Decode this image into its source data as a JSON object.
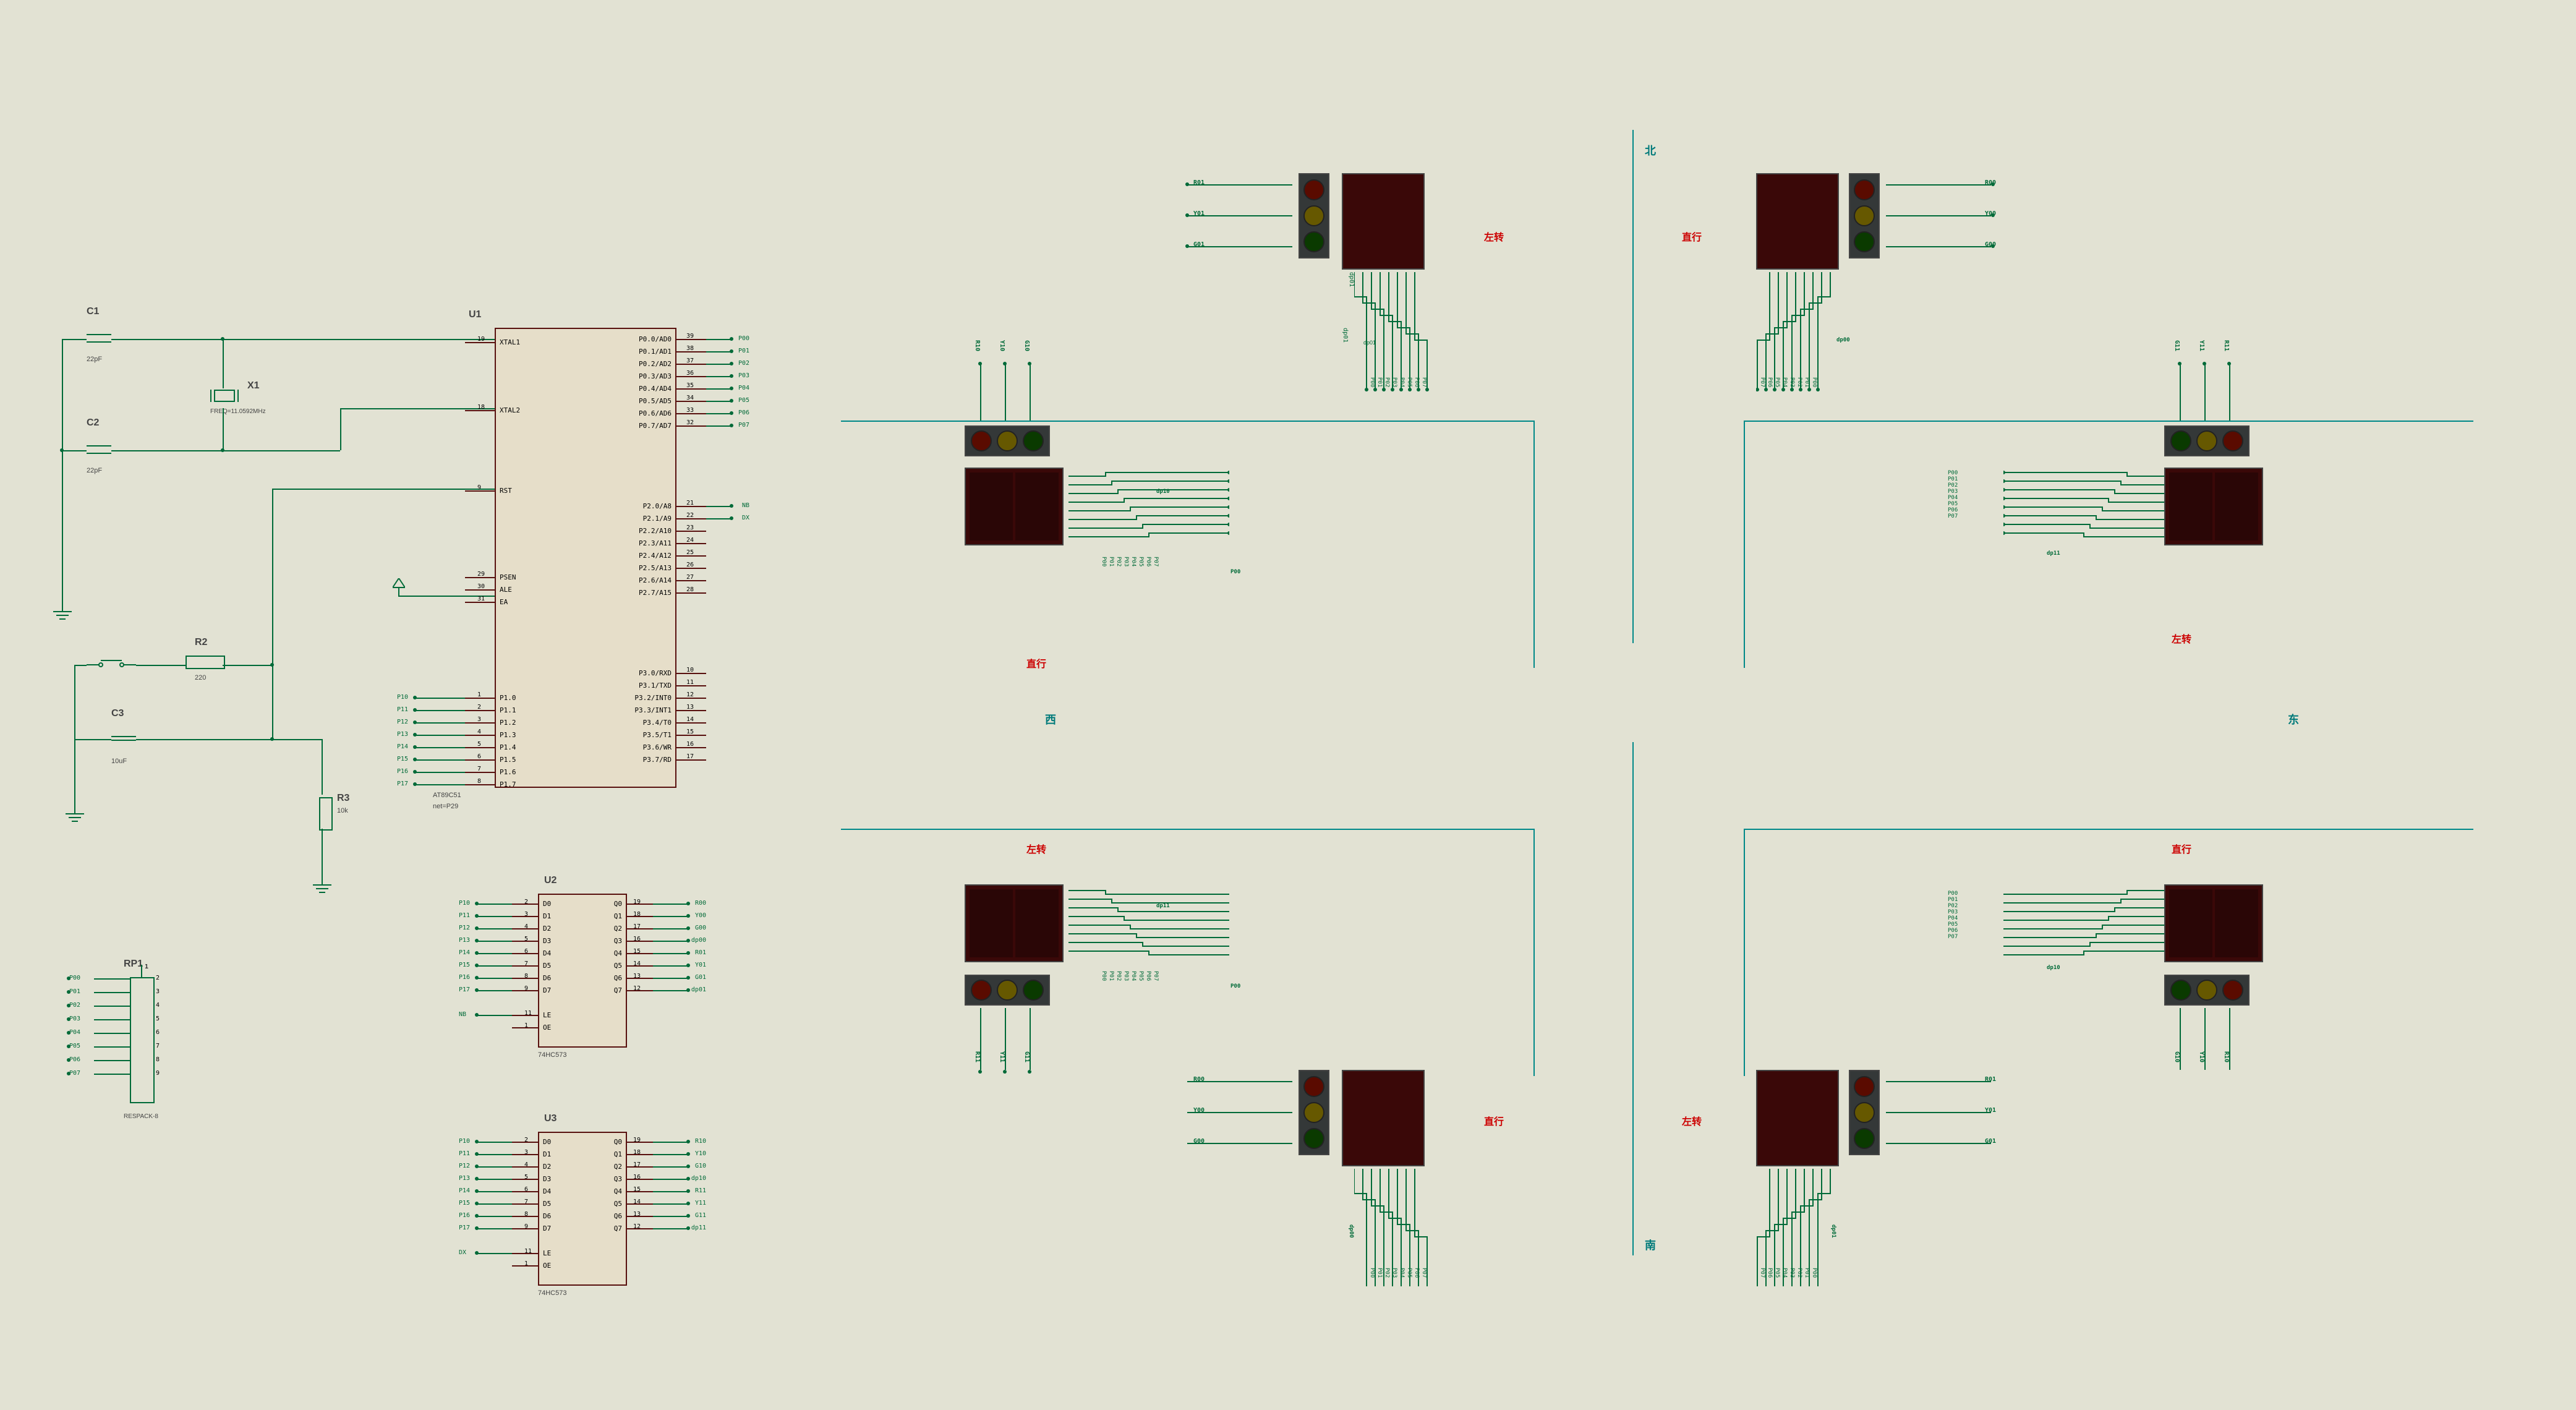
{
  "parts": {
    "c1": {
      "ref": "C1",
      "val": "22pF"
    },
    "c2": {
      "ref": "C2",
      "val": "22pF"
    },
    "c3": {
      "ref": "C3",
      "val": "10uF"
    },
    "x1": {
      "ref": "X1",
      "val": "FREQ=11.0592MHz"
    },
    "r2": {
      "ref": "R2",
      "val": "220"
    },
    "r3": {
      "ref": "R3",
      "val": "10k"
    },
    "u1": {
      "ref": "U1",
      "val": "AT89C51",
      "net": "net=P29"
    },
    "u2": {
      "ref": "U2",
      "val": "74HC573"
    },
    "u3": {
      "ref": "U3",
      "val": "74HC573"
    },
    "rp1": {
      "ref": "RP1",
      "val": "RESPACK-8"
    }
  },
  "rp1_pins": [
    "1",
    "",
    "P00",
    "P01",
    "P02",
    "P03",
    "P04",
    "P05",
    "P06",
    "P07"
  ],
  "u1_left": [
    {
      "n": "19",
      "t": "XTAL1"
    },
    {
      "n": "",
      "t": ""
    },
    {
      "n": "18",
      "t": "XTAL2"
    },
    {
      "n": "",
      "t": ""
    },
    {
      "n": "9",
      "t": "RST"
    },
    {
      "n": "",
      "t": ""
    },
    {
      "n": "29",
      "t": "PSEN"
    },
    {
      "n": "30",
      "t": "ALE"
    },
    {
      "n": "31",
      "t": "EA"
    },
    {
      "n": "",
      "t": ""
    },
    {
      "n": "",
      "t": "P1.0",
      "net": "P10"
    },
    {
      "n": "",
      "t": "P1.1",
      "net": "P11"
    },
    {
      "n": "",
      "t": "P1.2",
      "net": "P12"
    },
    {
      "n": "",
      "t": "P1.3",
      "net": "P13"
    },
    {
      "n": "",
      "t": "P1.4",
      "net": "P14"
    },
    {
      "n": "",
      "t": "P1.5",
      "net": "P15"
    },
    {
      "n": "",
      "t": "P1.6",
      "net": "P16"
    },
    {
      "n": "",
      "t": "P1.7",
      "net": "P17"
    },
    {
      "n": "",
      "t": ""
    }
  ],
  "u1_left_nums": [
    "19",
    "",
    "18",
    "",
    "9",
    "",
    "29",
    "30",
    "31",
    "",
    "1",
    "2",
    "3",
    "4",
    "5",
    "6",
    "7",
    "8",
    ""
  ],
  "u1_left_nets": [
    "",
    "",
    "",
    "",
    "",
    "",
    "",
    "",
    "",
    "",
    "P10",
    "P11",
    "P12",
    "P13",
    "P14",
    "P15",
    "P16",
    "P17",
    ""
  ],
  "u1_right": [
    {
      "n": "39",
      "t": "P0.0/AD0",
      "net": "P00"
    },
    {
      "n": "38",
      "t": "P0.1/AD1",
      "net": "P01"
    },
    {
      "n": "37",
      "t": "P0.2/AD2",
      "net": "P02"
    },
    {
      "n": "36",
      "t": "P0.3/AD3",
      "net": "P03"
    },
    {
      "n": "35",
      "t": "P0.4/AD4",
      "net": "P04"
    },
    {
      "n": "34",
      "t": "P0.5/AD5",
      "net": "P05"
    },
    {
      "n": "33",
      "t": "P0.6/AD6",
      "net": "P06"
    },
    {
      "n": "32",
      "t": "P0.7/AD7",
      "net": "P07"
    },
    {
      "n": "",
      "t": ""
    },
    {
      "n": "21",
      "t": "P2.0/A8",
      "net": "NB"
    },
    {
      "n": "22",
      "t": "P2.1/A9",
      "net": "DX"
    },
    {
      "n": "23",
      "t": "P2.2/A10",
      "net": ""
    },
    {
      "n": "24",
      "t": "P2.3/A11",
      "net": ""
    },
    {
      "n": "25",
      "t": "P2.4/A12",
      "net": ""
    },
    {
      "n": "26",
      "t": "P2.5/A13",
      "net": ""
    },
    {
      "n": "27",
      "t": "P2.6/A14",
      "net": ""
    },
    {
      "n": "28",
      "t": "P2.7/A15",
      "net": ""
    },
    {
      "n": "",
      "t": ""
    },
    {
      "n": "10",
      "t": "P3.0/RXD",
      "net": ""
    },
    {
      "n": "11",
      "t": "P3.1/TXD",
      "net": ""
    },
    {
      "n": "12",
      "t": "P3.2/INT0",
      "net": ""
    },
    {
      "n": "13",
      "t": "P3.3/INT1",
      "net": ""
    },
    {
      "n": "14",
      "t": "P3.4/T0",
      "net": ""
    },
    {
      "n": "15",
      "t": "P3.5/T1",
      "net": ""
    },
    {
      "n": "16",
      "t": "P3.6/WR",
      "net": ""
    },
    {
      "n": "17",
      "t": "P3.7/RD",
      "net": ""
    }
  ],
  "u2_left": [
    {
      "n": "2",
      "t": "D0",
      "net": "P10"
    },
    {
      "n": "3",
      "t": "D1",
      "net": "P11"
    },
    {
      "n": "4",
      "t": "D2",
      "net": "P12"
    },
    {
      "n": "5",
      "t": "D3",
      "net": "P13"
    },
    {
      "n": "6",
      "t": "D4",
      "net": "P14"
    },
    {
      "n": "7",
      "t": "D5",
      "net": "P15"
    },
    {
      "n": "8",
      "t": "D6",
      "net": "P16"
    },
    {
      "n": "9",
      "t": "D7",
      "net": "P17"
    },
    {
      "n": "",
      "t": ""
    },
    {
      "n": "11",
      "t": "LE",
      "net": "NB"
    },
    {
      "n": "1",
      "t": "OE",
      "net": ""
    }
  ],
  "u2_right": [
    {
      "n": "19",
      "t": "Q0",
      "net": "R00"
    },
    {
      "n": "18",
      "t": "Q1",
      "net": "Y00"
    },
    {
      "n": "17",
      "t": "Q2",
      "net": "G00"
    },
    {
      "n": "16",
      "t": "Q3",
      "net": "dp00"
    },
    {
      "n": "15",
      "t": "Q4",
      "net": "R01"
    },
    {
      "n": "14",
      "t": "Q5",
      "net": "Y01"
    },
    {
      "n": "13",
      "t": "Q6",
      "net": "G01"
    },
    {
      "n": "12",
      "t": "Q7",
      "net": "dp01"
    }
  ],
  "u3_left": [
    {
      "n": "2",
      "t": "D0",
      "net": "P10"
    },
    {
      "n": "3",
      "t": "D1",
      "net": "P11"
    },
    {
      "n": "4",
      "t": "D2",
      "net": "P12"
    },
    {
      "n": "5",
      "t": "D3",
      "net": "P13"
    },
    {
      "n": "6",
      "t": "D4",
      "net": "P14"
    },
    {
      "n": "7",
      "t": "D5",
      "net": "P15"
    },
    {
      "n": "8",
      "t": "D6",
      "net": "P16"
    },
    {
      "n": "9",
      "t": "D7",
      "net": "P17"
    },
    {
      "n": "",
      "t": ""
    },
    {
      "n": "11",
      "t": "LE",
      "net": "DX"
    },
    {
      "n": "1",
      "t": "OE",
      "net": ""
    }
  ],
  "u3_right": [
    {
      "n": "19",
      "t": "Q0",
      "net": "R10"
    },
    {
      "n": "18",
      "t": "Q1",
      "net": "Y10"
    },
    {
      "n": "17",
      "t": "Q2",
      "net": "G10"
    },
    {
      "n": "16",
      "t": "Q3",
      "net": "dp10"
    },
    {
      "n": "15",
      "t": "Q4",
      "net": "R11"
    },
    {
      "n": "14",
      "t": "Q5",
      "net": "Y11"
    },
    {
      "n": "13",
      "t": "Q6",
      "net": "G11"
    },
    {
      "n": "12",
      "t": "Q7",
      "net": "dp11"
    }
  ],
  "labels": {
    "zuozhuan": "左转",
    "zhixing": "直行",
    "bei": "北",
    "nan": "南",
    "dong": "东",
    "xi": "西"
  },
  "light_nets": {
    "north_left": {
      "r": "R01",
      "y": "Y01",
      "g": "G01"
    },
    "north_right": {
      "r": "R00",
      "y": "Y00",
      "g": "G00"
    },
    "east_top": {
      "r": "R11",
      "y": "Y11",
      "g": "G11"
    },
    "east_bot": {
      "r": "R10",
      "y": "Y10",
      "g": "G10"
    },
    "south_left": {
      "r": "R00",
      "y": "Y00",
      "g": "G00"
    },
    "south_right": {
      "r": "R01",
      "y": "Y01",
      "g": "G01"
    },
    "west_top": {
      "r": "R10",
      "y": "Y10",
      "g": "G10"
    },
    "west_bot": {
      "r": "R11",
      "y": "Y11",
      "g": "G11"
    }
  },
  "seg_nets": {
    "north_left": {
      "dp": "dp01",
      "p": [
        "P00",
        "P01",
        "P02",
        "P03",
        "P04",
        "P05",
        "P06",
        "P07"
      ]
    },
    "north_right": {
      "dp": "dp00",
      "p": [
        "P00",
        "P01",
        "P02",
        "P03",
        "P04",
        "P05",
        "P06",
        "P07"
      ]
    },
    "south_left": {
      "dp": "dp00",
      "p": [
        "P00",
        "P01",
        "P02",
        "P03",
        "P04",
        "P05",
        "P06",
        "P07"
      ]
    },
    "south_right": {
      "dp": "dp01",
      "p": [
        "P00",
        "P01",
        "P02",
        "P03",
        "P04",
        "P05",
        "P06",
        "P07"
      ]
    },
    "west_top": {
      "dp": "dp10",
      "p": [
        "P00",
        "P01",
        "P02",
        "P03",
        "P04",
        "P05",
        "P06",
        "P07"
      ]
    },
    "west_bot": {
      "dp": "dp11",
      "p": [
        "P00",
        "P01",
        "P02",
        "P03",
        "P04",
        "P05",
        "P06",
        "P07"
      ]
    },
    "east_top": {
      "dp": "dp11",
      "p": [
        "P00",
        "P01",
        "P02",
        "P03",
        "P04",
        "P05",
        "P06",
        "P07"
      ]
    },
    "east_bot": {
      "dp": "dp10",
      "p": [
        "P00",
        "P01",
        "P02",
        "P03",
        "P04",
        "P05",
        "P06",
        "P07"
      ]
    }
  }
}
